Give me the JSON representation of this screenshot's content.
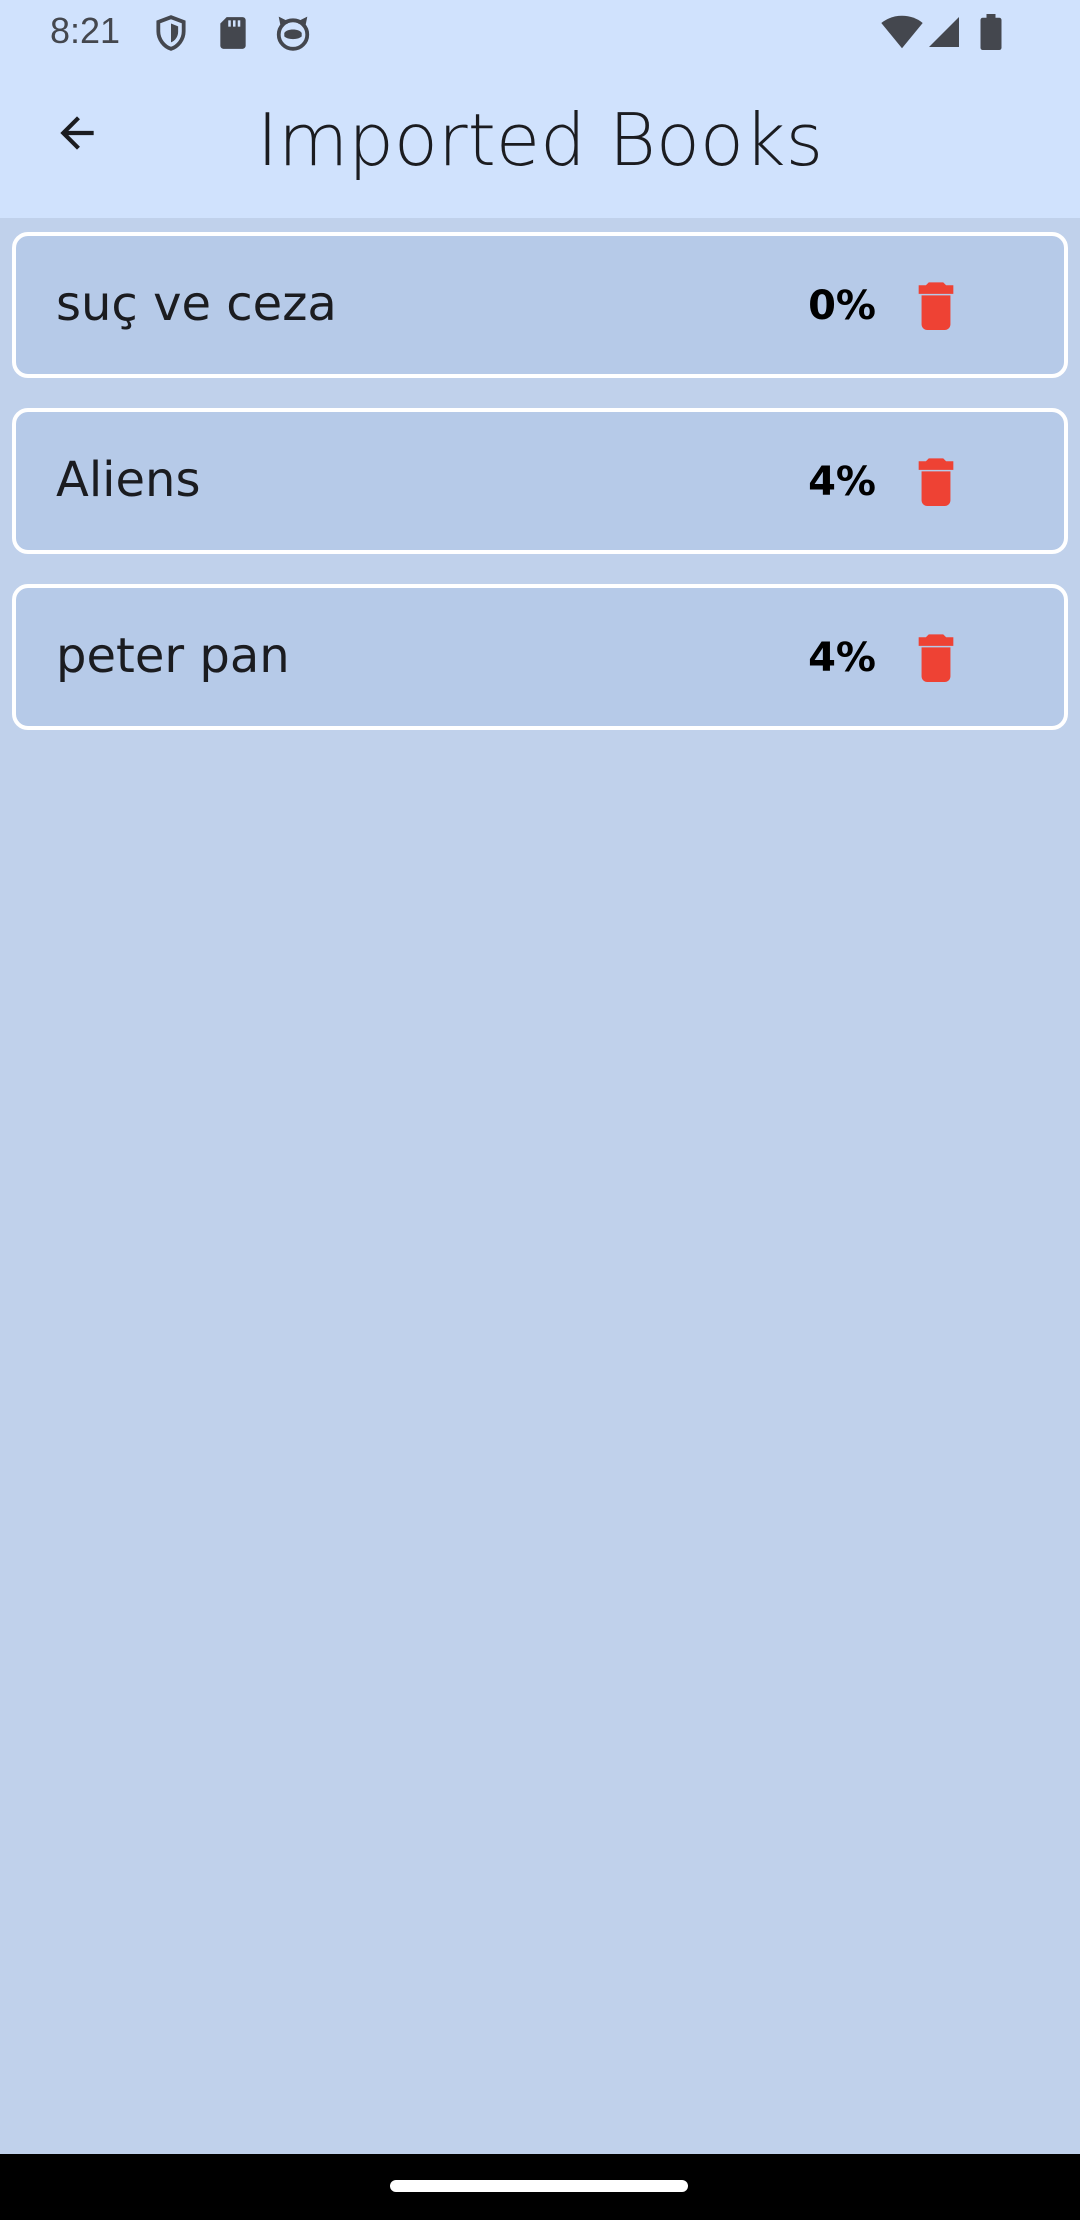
{
  "status_bar": {
    "time": "8:21",
    "icons_left": [
      "shield-icon",
      "sd-card-icon",
      "android-cat-icon"
    ],
    "icons_right": [
      "wifi-icon",
      "signal-icon",
      "battery-icon"
    ]
  },
  "app_bar": {
    "title": "Imported Books",
    "back_icon": "arrow-back-icon"
  },
  "books": [
    {
      "title": "suç ve ceza",
      "progress": "0%"
    },
    {
      "title": "Aliens",
      "progress": "4%"
    },
    {
      "title": "peter pan",
      "progress": "4%"
    }
  ],
  "colors": {
    "top_bar_bg": "#d0e2fd",
    "page_bg": "#c0d1eb",
    "card_bg": "#b6cae8",
    "card_border": "#ffffff",
    "delete_icon": "#ee4234",
    "nav_bar_bg": "#000000"
  }
}
